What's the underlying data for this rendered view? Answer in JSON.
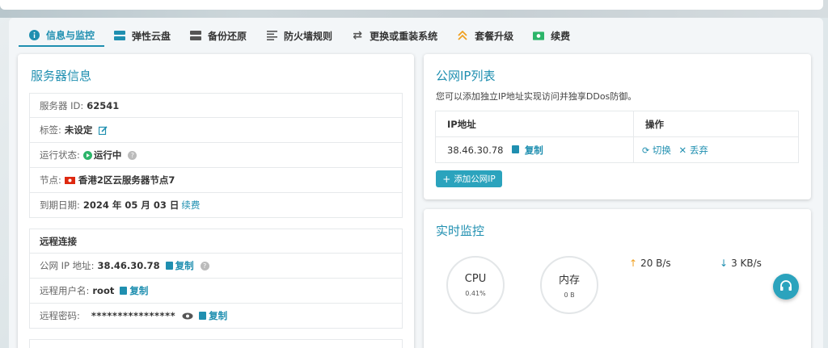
{
  "tabs": [
    {
      "label": "信息与监控",
      "icon": "info-icon"
    },
    {
      "label": "弹性云盘",
      "icon": "disk-icon"
    },
    {
      "label": "备份还原",
      "icon": "backup-icon"
    },
    {
      "label": "防火墙规则",
      "icon": "list-icon"
    },
    {
      "label": "更换或重装系统",
      "icon": "swap-icon"
    },
    {
      "label": "套餐升级",
      "icon": "upgrade-icon"
    },
    {
      "label": "续费",
      "icon": "money-icon"
    }
  ],
  "server_info": {
    "title": "服务器信息",
    "id_label": "服务器 ID:",
    "id_value": "62541",
    "tag_label": "标签:",
    "tag_value": "未设定",
    "status_label": "运行状态:",
    "status_value": "运行中",
    "node_label": "节点:",
    "node_value": "香港2区云服务器节点7",
    "expire_label": "到期日期:",
    "expire_value": "2024 年 05 月 03 日",
    "renew_link": "续费"
  },
  "remote": {
    "title": "远程连接",
    "ip_label": "公网 IP 地址:",
    "ip_value": "38.46.30.78",
    "user_label": "远程用户名:",
    "user_value": "root",
    "pwd_label": "远程密码:",
    "pwd_value": "****************",
    "copy_label": "复制"
  },
  "public_ip": {
    "title": "公网IP列表",
    "desc": "您可以添加独立IP地址实现访问并独享DDos防御。",
    "col_ip": "IP地址",
    "col_action": "操作",
    "rows": [
      {
        "ip": "38.46.30.78",
        "copy": "复制",
        "switch": "切换",
        "discard": "丢弃"
      }
    ],
    "add_button": "添加公网IP"
  },
  "monitor": {
    "title": "实时监控",
    "cpu_label": "CPU",
    "cpu_value": "0.41%",
    "mem_label": "内存",
    "mem_value": "0 B",
    "upload": "20 B/s",
    "download": "3 KB/s"
  },
  "colors": {
    "accent": "#1f8fb0",
    "button": "#2ba3bd",
    "status_green": "#2db56a"
  }
}
